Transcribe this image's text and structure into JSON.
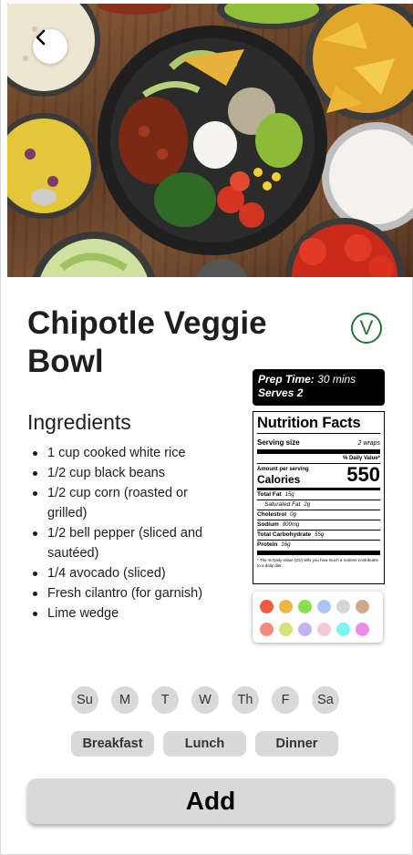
{
  "recipe": {
    "title": "Chipotle Veggie Bowl",
    "vegetarian_badge": "V"
  },
  "hero": {
    "image_alt": "Chipotle veggie bowl with toppings",
    "back_icon": "chevron-left-icon"
  },
  "ingredients": {
    "heading": "Ingredients",
    "items": [
      "1 cup cooked white rice",
      "1/2 cup black beans",
      "1/2 cup corn (roasted or grilled)",
      "1/2 bell pepper (sliced and sautéed)",
      "1/4 avocado (sliced)",
      "Fresh cilantro (for garnish)",
      "Lime wedge"
    ]
  },
  "prep": {
    "prep_label": "Prep Time:",
    "prep_value": "30 mins",
    "serves": "Serves 2"
  },
  "nutrition": {
    "title": "Nutrition Facts",
    "serving_label": "Serving size",
    "serving_value": "2 wraps",
    "daily_value_label": "% Daily Value*",
    "amount_label": "Amount per serving",
    "calories_label": "Calories",
    "calories_value": "550",
    "rows": [
      {
        "label": "Total Fat",
        "value": "15g"
      },
      {
        "label": "Saturated Fat",
        "value": "2g"
      },
      {
        "label": "Cholestrol",
        "value": "0g"
      },
      {
        "label": "Sodium",
        "value": "800mg"
      },
      {
        "label": "Total Carbohydrate",
        "value": "55g"
      },
      {
        "label": "Protein",
        "value": "16g"
      }
    ],
    "footnote": "* The % Daily Value (DV) tells you how much a nutrient contributes to a daily diet."
  },
  "palette": {
    "colors": [
      "#f35b3c",
      "#f0b544",
      "#84e04c",
      "#a9c6f5",
      "#d6d6d6",
      "#cfa98b",
      "#f48a7e",
      "#d6e27a",
      "#c3b2f4",
      "#f5c9dc",
      "#7ef3f3",
      "#ef8ce8"
    ]
  },
  "days": [
    "Su",
    "M",
    "T",
    "W",
    "Th",
    "F",
    "Sa"
  ],
  "meals": [
    "Breakfast",
    "Lunch",
    "Dinner"
  ],
  "add_label": "Add"
}
